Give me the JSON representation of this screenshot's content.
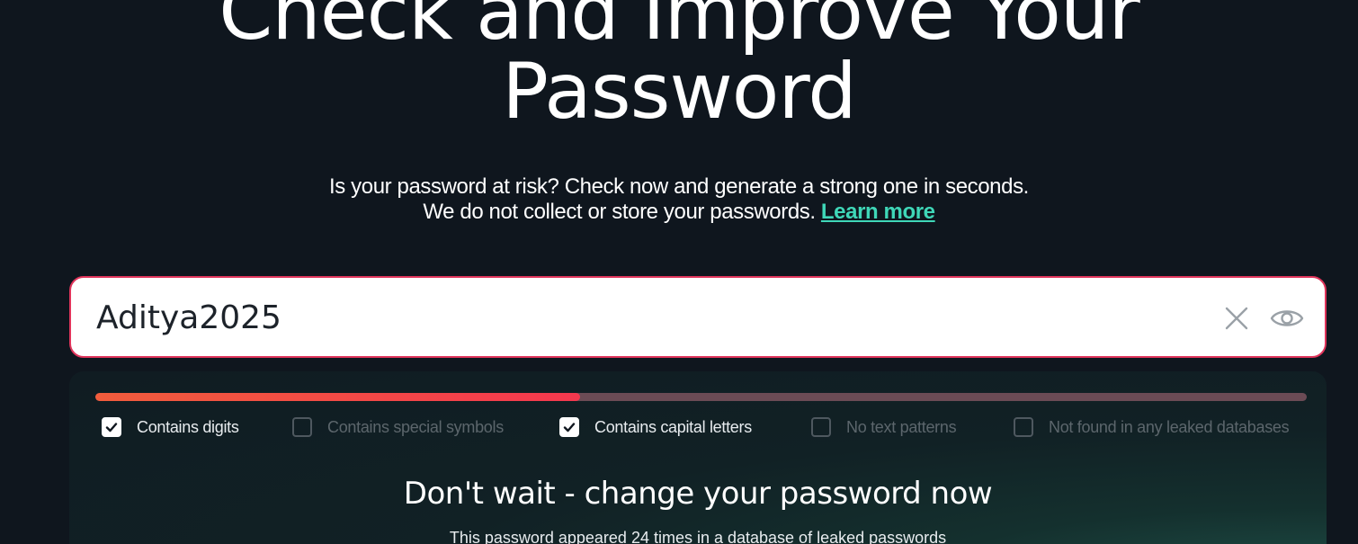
{
  "hero": {
    "title_line1": "Check and Improve Your",
    "title_line2": "Password"
  },
  "subtitle": {
    "line1": "Is your password at risk? Check now and generate a strong one in seconds.",
    "line2": "We do not collect or store your passwords.",
    "link": "Learn more"
  },
  "password_field": {
    "value": "Aditya2025",
    "clear_icon": "close-icon",
    "visibility_icon": "eye-icon",
    "border_color": "#e0345b"
  },
  "strength_meter": {
    "level": 0.4,
    "fill_color": "#f4384e",
    "track_color": "#6b4b55"
  },
  "criteria": [
    {
      "label": "Contains digits",
      "checked": true
    },
    {
      "label": "Contains special symbols",
      "checked": false
    },
    {
      "label": "Contains capital letters",
      "checked": true
    },
    {
      "label": "No text patterns",
      "checked": false
    },
    {
      "label": "Not found in any leaked databases",
      "checked": false
    }
  ],
  "result": {
    "title": "Don't wait - change your password now",
    "description": "This password appeared 24 times in a database of leaked passwords"
  },
  "colors": {
    "background": "#0f161e",
    "accent": "#3fd7b8"
  }
}
